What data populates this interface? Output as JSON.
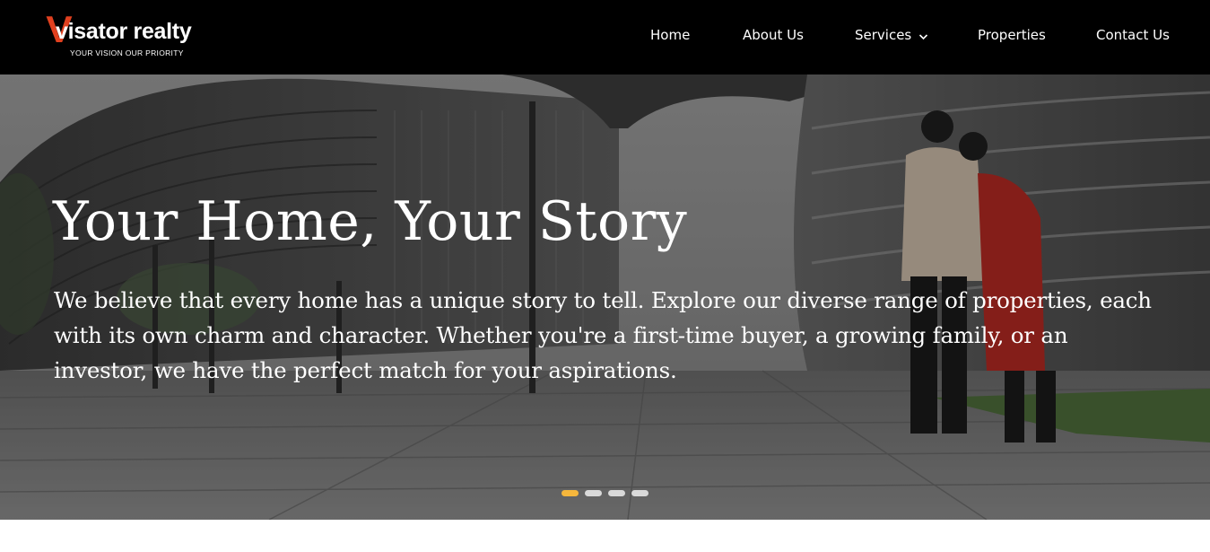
{
  "brand": {
    "letter": "V",
    "word": "visator realty",
    "tagline": "YOUR VISION OUR PRIORITY",
    "accent_color": "#e0401f"
  },
  "nav": {
    "items": [
      {
        "label": "Home"
      },
      {
        "label": "About Us"
      },
      {
        "label": "Services",
        "icon": "chevron-down-icon"
      },
      {
        "label": "Properties"
      },
      {
        "label": "Contact Us"
      }
    ]
  },
  "hero": {
    "title": "Your Home, Your Story",
    "description": "We believe that every home has a unique story to tell. Explore our diverse range of properties, each with its own charm and character. Whether you're a first-time buyer, a growing family, or an investor, we have the perfect match for your aspirations.",
    "slides": 4,
    "active_slide": 1,
    "active_dot_color": "#f6b73c",
    "background": "modern-curved-buildings-plaza-couple-walking"
  }
}
